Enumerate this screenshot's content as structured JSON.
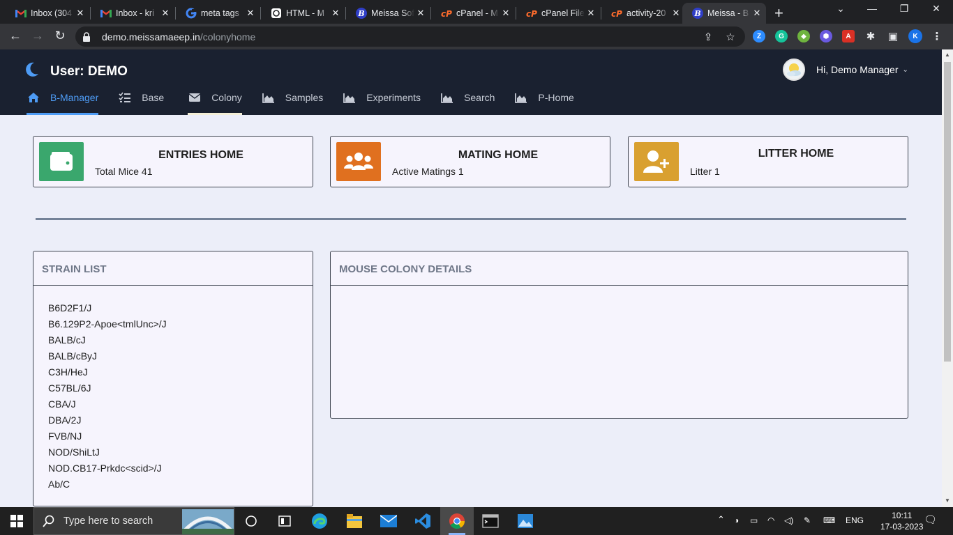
{
  "browser": {
    "tabs": [
      {
        "title": "Inbox (304",
        "favicon": "gmail-icon"
      },
      {
        "title": "Inbox - kri",
        "favicon": "gmail-icon"
      },
      {
        "title": "meta tags",
        "favicon": "google-icon"
      },
      {
        "title": "HTML - M",
        "favicon": "openai-icon"
      },
      {
        "title": "Meissa Sof",
        "favicon": "meissa-icon"
      },
      {
        "title": "cPanel - M",
        "favicon": "cpanel-icon"
      },
      {
        "title": "cPanel File",
        "favicon": "cpanel-icon"
      },
      {
        "title": "activity-20",
        "favicon": "cpanel-icon"
      },
      {
        "title": "Meissa - B",
        "favicon": "meissa-icon",
        "active": true
      }
    ],
    "url_host": "demo.meissamaeep.in",
    "url_path": "/colonyhome",
    "profile_initial": "K"
  },
  "app": {
    "title": "User: DEMO",
    "greeting": "Hi, Demo Manager",
    "nav": [
      {
        "label": "B-Manager",
        "icon": "home-icon",
        "state": "active"
      },
      {
        "label": "Base",
        "icon": "list-check-icon"
      },
      {
        "label": "Colony",
        "icon": "envelope-icon",
        "state": "highlighted"
      },
      {
        "label": "Samples",
        "icon": "area-chart-icon"
      },
      {
        "label": "Experiments",
        "icon": "area-chart-icon"
      },
      {
        "label": "Search",
        "icon": "area-chart-icon"
      },
      {
        "label": "P-Home",
        "icon": "area-chart-icon"
      }
    ]
  },
  "cards": [
    {
      "title": "ENTRIES HOME",
      "subtitle": "Total Mice 41",
      "icon": "wallet-icon",
      "color": "#3aa76d"
    },
    {
      "title": "MATING HOME",
      "subtitle": "Active Matings 1",
      "icon": "users-icon",
      "color": "#e0701f"
    },
    {
      "title": "LITTER HOME",
      "subtitle": "Litter 1",
      "icon": "user-plus-icon",
      "color": "#d9a030"
    }
  ],
  "strain_panel": {
    "title": "STRAIN LIST",
    "strains": [
      "B6D2F1/J",
      "B6.129P2-Apoe<tmlUnc>/J",
      "BALB/cJ",
      "BALB/cByJ",
      "C3H/HeJ",
      "C57BL/6J",
      "CBA/J",
      "DBA/2J",
      "FVB/NJ",
      "NOD/ShiLtJ",
      "NOD.CB17-Prkdc<scid>/J",
      "Ab/C"
    ]
  },
  "details_panel": {
    "title": "MOUSE COLONY DETAILS"
  },
  "taskbar": {
    "search_placeholder": "Type here to search",
    "language": "ENG",
    "time": "10:11",
    "date": "17-03-2023"
  }
}
